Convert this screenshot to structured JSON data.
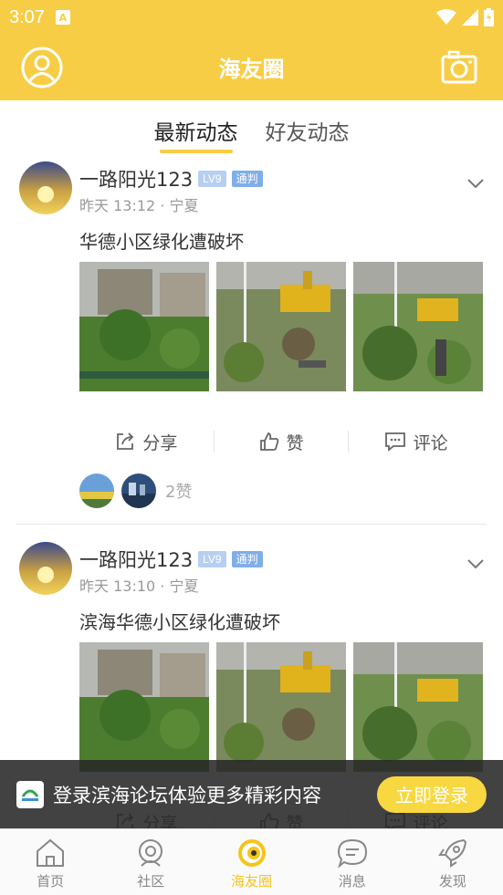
{
  "status": {
    "time": "3:07"
  },
  "header": {
    "title": "海友圈"
  },
  "tabs": [
    {
      "label": "最新动态",
      "active": true
    },
    {
      "label": "好友动态",
      "active": false
    }
  ],
  "posts": [
    {
      "user": "一路阳光123",
      "level": "LV9",
      "rank": "通判",
      "time": "昨天 13:12 · 宁夏",
      "text": "华德小区绿化遭破坏",
      "actions": {
        "share": "分享",
        "like": "赞",
        "comment": "评论"
      },
      "likes": "2赞"
    },
    {
      "user": "一路阳光123",
      "level": "LV9",
      "rank": "通判",
      "time": "昨天 13:10 · 宁夏",
      "text": "滨海华德小区绿化遭破坏",
      "actions": {
        "share": "分享",
        "like": "赞",
        "comment": "评论"
      }
    }
  ],
  "login_banner": {
    "text": "登录滨海论坛体验更多精彩内容",
    "button": "立即登录"
  },
  "bottom_nav": [
    {
      "label": "首页",
      "icon": "home-icon",
      "active": false
    },
    {
      "label": "社区",
      "icon": "community-icon",
      "active": false
    },
    {
      "label": "海友圈",
      "icon": "friends-circle-icon",
      "active": true
    },
    {
      "label": "消息",
      "icon": "message-icon",
      "active": false
    },
    {
      "label": "发现",
      "icon": "rocket-icon",
      "active": false
    }
  ],
  "colors": {
    "accent": "#f8cd46",
    "nav_active": "#f5c518",
    "level_badge": "#b7cff2",
    "rank_badge": "#7faee9"
  }
}
